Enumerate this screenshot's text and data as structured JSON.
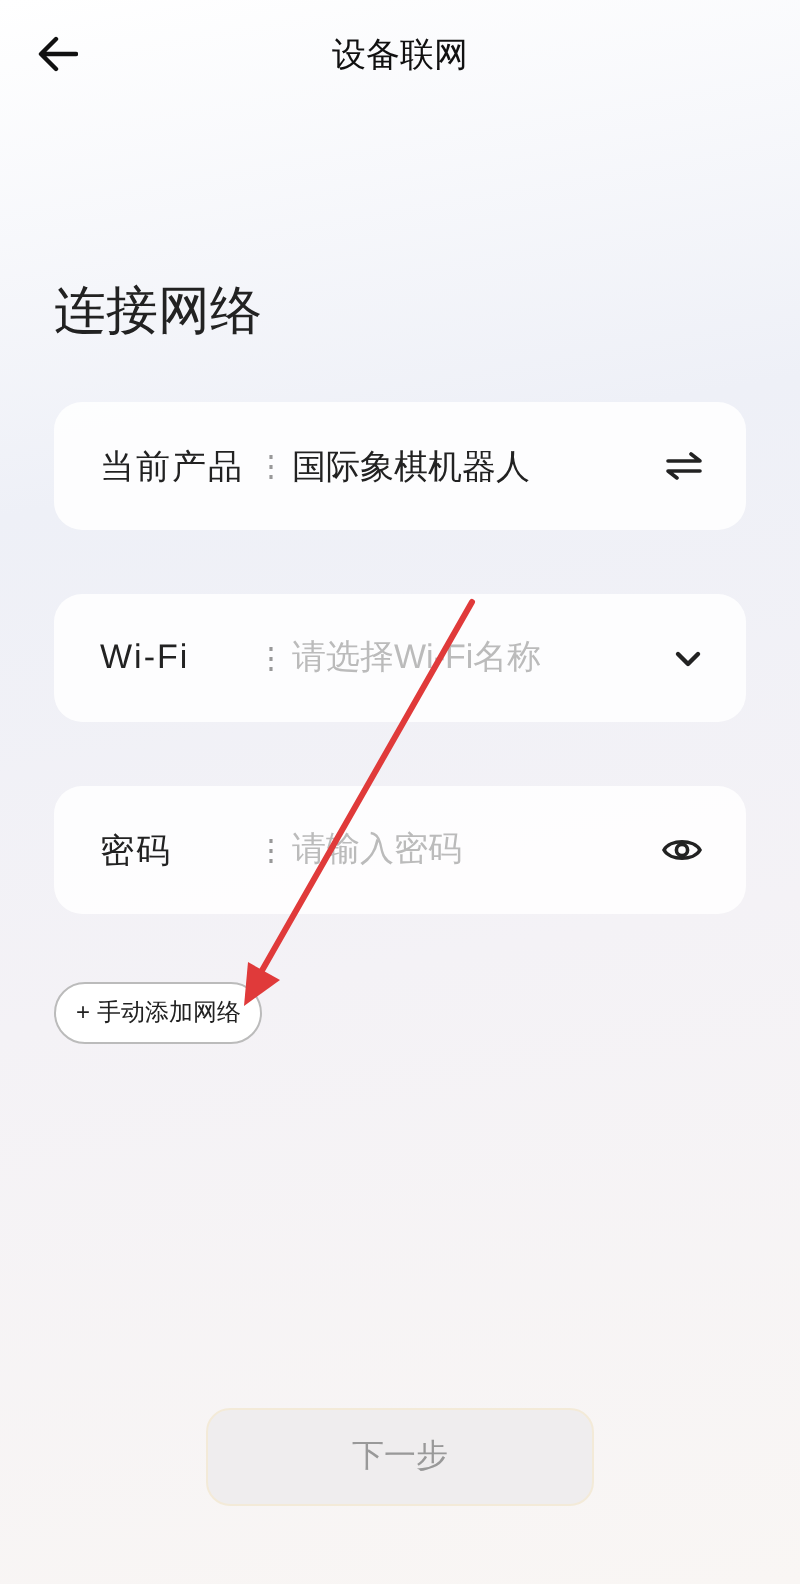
{
  "header": {
    "title": "设备联网"
  },
  "heading": "连接网络",
  "fields": [
    {
      "label": "当前产品",
      "separator": "⋮",
      "kind": "switch",
      "value": "国际象棋机器人"
    },
    {
      "label": "Wi-Fi",
      "separator": "⋮",
      "kind": "dropdown",
      "placeholder": "请选择Wi-Fi名称"
    },
    {
      "label": "密码",
      "separator": "⋮",
      "kind": "password",
      "placeholder": "请输入密码"
    }
  ],
  "add_network": {
    "label": "+ 手动添加网络"
  },
  "next_button": {
    "label": "下一步",
    "disabled": true
  }
}
